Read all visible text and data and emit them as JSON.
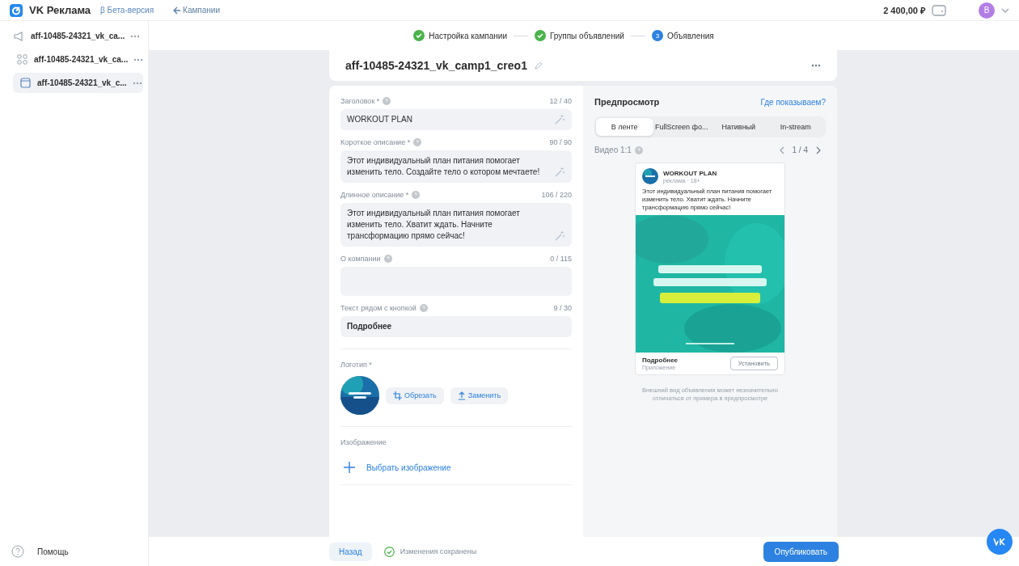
{
  "header": {
    "brand": "VK Реклама",
    "beta": "β Бета-версия",
    "back": "Кампании",
    "balance": "2 400,00 ₽",
    "avatar": "В"
  },
  "sidebar": {
    "items": [
      {
        "kind": "campaign",
        "label": "aff-10485-24321_vk_ca...",
        "selected": false
      },
      {
        "kind": "group",
        "label": "aff-10485-24321_vk_ca...",
        "selected": false
      },
      {
        "kind": "ad",
        "label": "aff-10485-24321_vk_c...",
        "selected": true
      }
    ],
    "help": "Помощь"
  },
  "steps": [
    {
      "label": "Настройка кампании",
      "done": true
    },
    {
      "label": "Группы объявлений",
      "done": true
    },
    {
      "label": "Объявления",
      "done": false,
      "number": "3"
    }
  ],
  "title": "aff-10485-24321_vk_camp1_creo1",
  "fields": [
    {
      "kind": "text",
      "label": "Заголовок *",
      "counter": "12 / 40",
      "value": "WORKOUT PLAN",
      "magic": true
    },
    {
      "kind": "text",
      "label": "Короткое описание *",
      "counter": "90 / 90",
      "value": "Этот индивидуальный план питания помогает изменить тело. Создайте тело о котором мечтаете!",
      "magic": true
    },
    {
      "kind": "text",
      "label": "Длинное описание *",
      "counter": "106 / 220",
      "value": "Этот индивидуальный план питания помогает изменить тело. Хватит ждать. Начните трансформацию прямо сейчас!",
      "magic": true
    },
    {
      "kind": "area",
      "label": "О компании",
      "counter": "0 / 115",
      "magic": false
    },
    {
      "kind": "text",
      "label": "Текст рядом с кнопкой",
      "counter": "9 / 30",
      "value": "Подробнее",
      "magic": false
    }
  ],
  "logo": {
    "label": "Логотип *",
    "crop": "Обрезать",
    "replace": "Заменить"
  },
  "image": {
    "label": "Изображение",
    "choose": "Выбрать изображение"
  },
  "preview": {
    "title": "Предпросмотр",
    "where": "Где показываем?",
    "tabs": [
      {
        "label": "В ленте",
        "selected": true
      },
      {
        "label": "FullScreen фо...",
        "selected": false
      },
      {
        "label": "Нативный",
        "selected": false
      },
      {
        "label": "In-stream",
        "selected": false
      }
    ],
    "format": "Видео 1:1",
    "pager": "1 / 4",
    "ad": {
      "name": "WORKOUT PLAN",
      "meta": "реклама · 18+",
      "text": "Этот индивидуальный план питания помогает изменить тело. Хватит ждать. Начните трансформацию прямо сейчас!",
      "cta_title": "Подробнее",
      "cta_sub": "Приложение",
      "button": "Установить"
    },
    "note": "Внешний вид объявления может незначительно отличаться от примера в предпросмотре"
  },
  "footer": {
    "back": "Назад",
    "saved": "Изменения сохранены",
    "publish": "Опубликовать"
  }
}
